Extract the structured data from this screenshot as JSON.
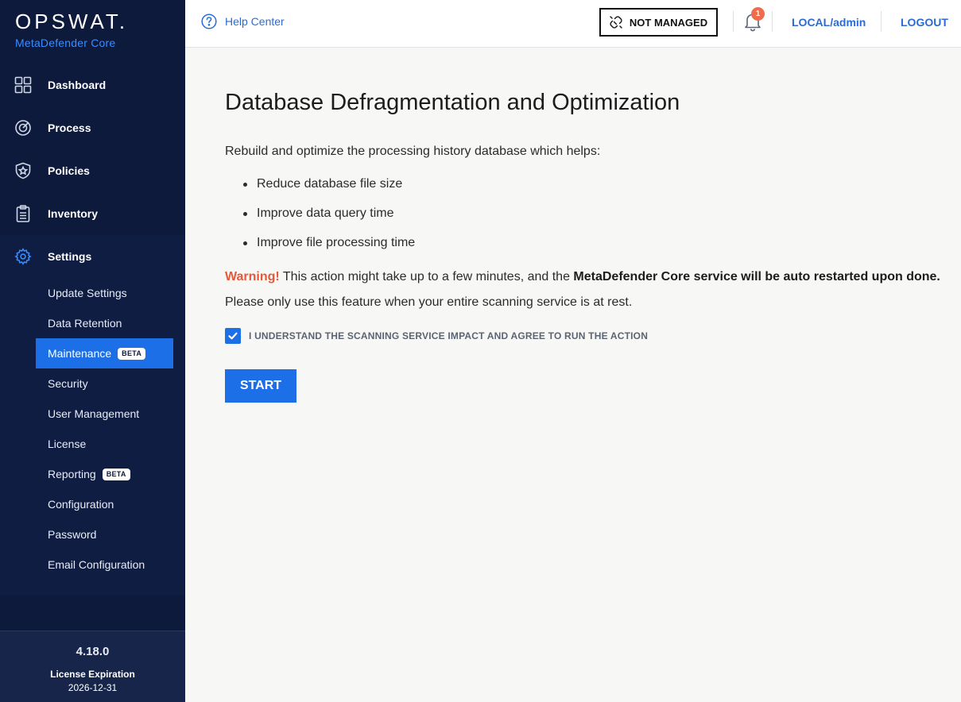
{
  "brand": {
    "name": "OPSWAT.",
    "product": "MetaDefender Core"
  },
  "nav": [
    {
      "id": "dashboard",
      "label": "Dashboard",
      "icon": "dashboard-grid-icon"
    },
    {
      "id": "process",
      "label": "Process",
      "icon": "target-icon"
    },
    {
      "id": "policies",
      "label": "Policies",
      "icon": "shield-star-icon"
    },
    {
      "id": "inventory",
      "label": "Inventory",
      "icon": "clipboard-icon"
    }
  ],
  "settings": {
    "label": "Settings",
    "icon": "gear-icon",
    "items": [
      {
        "label": "Update Settings"
      },
      {
        "label": "Data Retention"
      },
      {
        "label": "Maintenance",
        "badge": "BETA",
        "active": true
      },
      {
        "label": "Security"
      },
      {
        "label": "User Management"
      },
      {
        "label": "License"
      },
      {
        "label": "Reporting",
        "badge": "BETA"
      },
      {
        "label": "Configuration"
      },
      {
        "label": "Password"
      },
      {
        "label": "Email Configuration"
      }
    ]
  },
  "footer": {
    "version": "4.18.0",
    "license_label": "License Expiration",
    "license_date": "2026-12-31"
  },
  "header": {
    "help": "Help Center",
    "managed_status": "NOT MANAGED",
    "notification_count": "1",
    "user": "LOCAL/admin",
    "logout": "LOGOUT"
  },
  "main": {
    "title": "Database Defragmentation and Optimization",
    "intro": "Rebuild and optimize the processing history database which helps:",
    "bullets": [
      "Reduce database file size",
      "Improve data query time",
      "Improve file processing time"
    ],
    "warning_label": "Warning!",
    "warning_text": " This action might take up to a few minutes, and the ",
    "warning_bold": "MetaDefender Core service will be auto restarted upon done.",
    "note": "Please only use this feature when your entire scanning service is at rest.",
    "agree_text": "I UNDERSTAND THE SCANNING SERVICE IMPACT AND AGREE TO RUN THE ACTION",
    "agree_checked": true,
    "start_label": "START"
  },
  "colors": {
    "sidebar": "#0e1a3c",
    "accent": "#1d6fe8",
    "warning": "#e35a3a",
    "link": "#2a6bd6"
  }
}
